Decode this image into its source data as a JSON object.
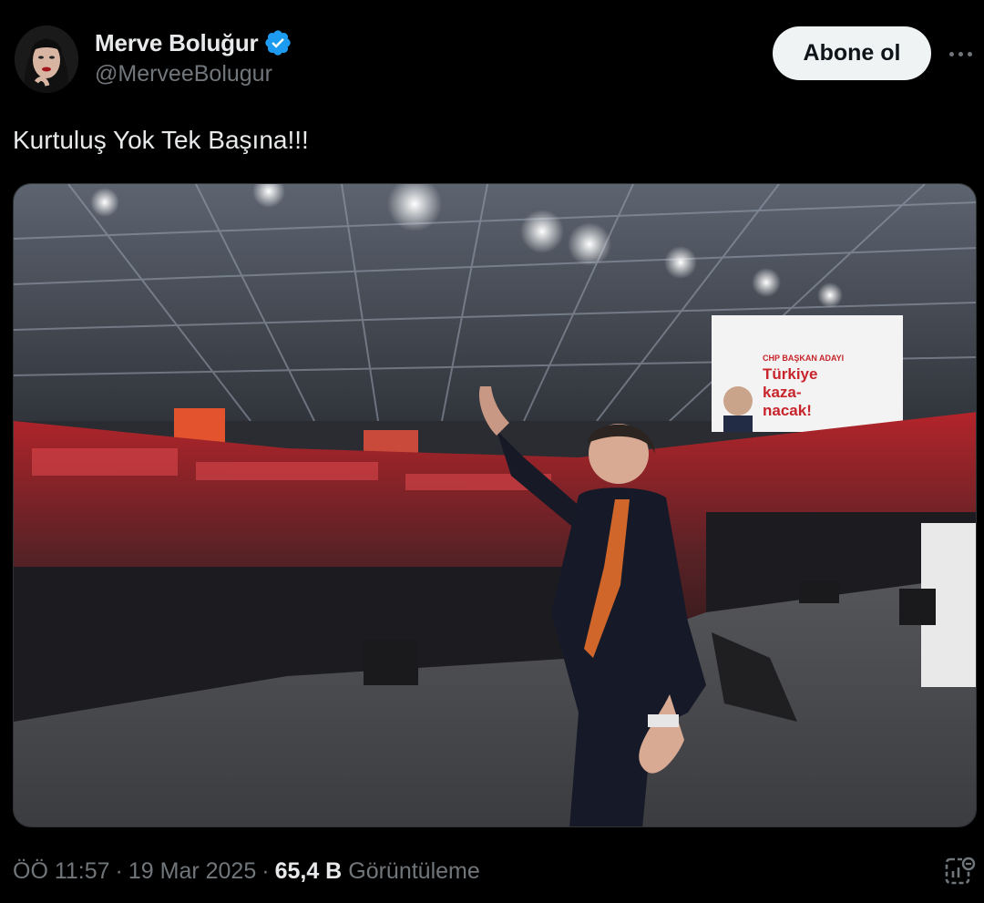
{
  "author": {
    "display_name": "Merve Boluğur",
    "handle": "@MerveeBolugur",
    "verified_icon": "verified-badge-icon",
    "avatar": "profile-avatar"
  },
  "actions": {
    "follow_label": "Abone ol",
    "more_icon": "more-options-icon"
  },
  "tweet": {
    "text": "Kurtuluş Yok Tek Başına!!!",
    "media_banner": {
      "line1": "CHP BAŞKAN ADAYI",
      "line2": "Türkiye",
      "line3": "kaza-",
      "line4": "nacak!"
    }
  },
  "meta": {
    "time": "ÖÖ 11:57",
    "date": "19 Mar 2025",
    "views_count": "65,4 B",
    "views_label": "Görüntüleme",
    "analytics_icon": "analytics-icon"
  },
  "colors": {
    "background": "#000000",
    "text": "#e7e9ea",
    "secondary": "#71767b",
    "verified": "#1d9bf0",
    "follow_bg": "#eff3f4"
  }
}
